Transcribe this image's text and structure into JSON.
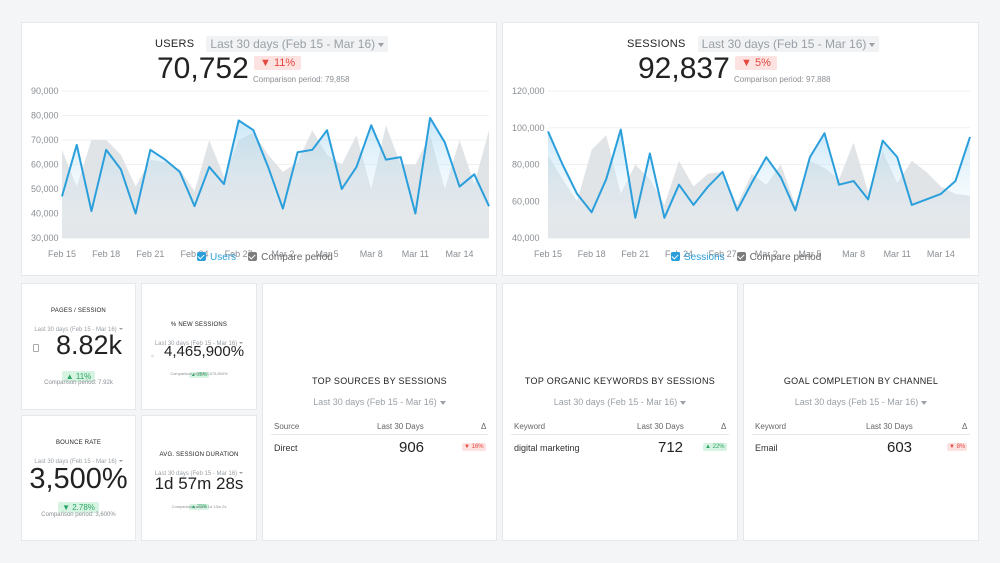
{
  "users": {
    "title": "USERS",
    "date_range": "Last 30 days (Feb 15 - Mar 16)",
    "value": "70,752",
    "change": "11%",
    "comparison": "Comparison period: 79,858",
    "legend_primary": "Users",
    "legend_compare": "Compare period"
  },
  "sessions": {
    "title": "SESSIONS",
    "date_range": "Last 30 days (Feb 15 - Mar 16)",
    "value": "92,837",
    "change": "5%",
    "comparison": "Comparison period: 97,888",
    "legend_primary": "Sessions",
    "legend_compare": "Compare period"
  },
  "pages_session": {
    "title": "PAGES / SESSION",
    "date_range": "Last 30 days (Feb 15 - Mar 16)",
    "value": "8.82k",
    "change": "11%",
    "comparison": "Comparison period: 7.92k"
  },
  "new_sessions": {
    "title": "% NEW SESSIONS",
    "date_range": "Last 30 days (Feb 15 - Mar 16)",
    "value": "4,465,900%",
    "change": "25%",
    "comparison": "Comparison period: 3,575,800%"
  },
  "bounce_rate": {
    "title": "BOUNCE RATE",
    "date_range": "Last 30 days (Feb 15 - Mar 16)",
    "value": "3,500%",
    "change": "2.78%",
    "comparison": "Comparison period: 3,600%"
  },
  "avg_duration": {
    "title": "AVG. SESSION DURATION",
    "date_range": "Last 30 days (Feb 15 - Mar 16)",
    "value": "1d 57m 28s",
    "change": "23%",
    "comparison": "Comparison period: 1d 13m 2s"
  },
  "top_sources": {
    "title": "TOP SOURCES BY SESSIONS",
    "date_range": "Last 30 days (Feb 15 - Mar 16)",
    "col1": "Source",
    "col2": "Last 30 Days",
    "col3": "Δ",
    "row_label": "Direct",
    "row_value": "906",
    "row_change": "16%"
  },
  "top_keywords": {
    "title": "TOP ORGANIC KEYWORDS BY SESSIONS",
    "date_range": "Last 30 days (Feb 15 - Mar 16)",
    "col1": "Keyword",
    "col2": "Last 30 Days",
    "col3": "Δ",
    "row_label": "digital marketing",
    "row_value": "712",
    "row_change": "22%"
  },
  "goal_completion": {
    "title": "GOAL COMPLETION BY CHANNEL",
    "date_range": "Last 30 days (Feb 15 - Mar 16)",
    "col1": "Keyword",
    "col2": "Last 30 Days",
    "col3": "Δ",
    "row_label": "Email",
    "row_value": "603",
    "row_change": "8%"
  },
  "chart_data": [
    {
      "type": "area",
      "ylim": [
        30000,
        90000
      ],
      "yticks": [
        "30,000",
        "40,000",
        "50,000",
        "60,000",
        "70,000",
        "80,000",
        "90,000"
      ],
      "ytick_values": [
        30000,
        40000,
        50000,
        60000,
        70000,
        80000,
        90000
      ],
      "xticks": [
        "Feb 15",
        "Feb 18",
        "Feb 21",
        "Feb 24",
        "Feb 27",
        "Mar 2",
        "Mar 5",
        "Mar 8",
        "Mar 11",
        "Mar 14"
      ],
      "series": [
        {
          "name": "Users",
          "values": [
            47000,
            68000,
            41000,
            66000,
            58000,
            40000,
            66000,
            62000,
            57000,
            43000,
            59000,
            52000,
            78000,
            74000,
            59000,
            42000,
            65000,
            66000,
            74000,
            50000,
            59000,
            76000,
            62000,
            63000,
            40000,
            79000,
            69000,
            51000,
            56000,
            43000
          ]
        },
        {
          "name": "Compare period",
          "values": [
            66000,
            51000,
            70000,
            70000,
            64000,
            51000,
            62000,
            61000,
            58000,
            49000,
            70000,
            55000,
            70000,
            73000,
            64000,
            57000,
            61000,
            74000,
            64000,
            60000,
            72000,
            50000,
            76000,
            60000,
            60000,
            72000,
            50000,
            70000,
            52000,
            74000
          ]
        }
      ]
    },
    {
      "type": "area",
      "ylim": [
        40000,
        120000
      ],
      "yticks": [
        "40,000",
        "60,000",
        "80,000",
        "100,000",
        "120,000"
      ],
      "ytick_values": [
        40000,
        60000,
        80000,
        100000,
        120000
      ],
      "xticks": [
        "Feb 15",
        "Feb 18",
        "Feb 21",
        "Feb 24",
        "Feb 27",
        "Mar 2",
        "Mar 5",
        "Mar 8",
        "Mar 11",
        "Mar 14"
      ],
      "series": [
        {
          "name": "Sessions",
          "values": [
            98000,
            80000,
            64000,
            54000,
            72000,
            99000,
            51000,
            86000,
            51000,
            69000,
            58000,
            68000,
            76000,
            55000,
            70000,
            84000,
            73000,
            55000,
            84000,
            97000,
            69000,
            71000,
            61000,
            93000,
            84000,
            58000,
            61000,
            64000,
            71000,
            95000
          ]
        },
        {
          "name": "Compare period",
          "values": [
            85000,
            72000,
            60000,
            88000,
            96000,
            64000,
            80000,
            72000,
            58000,
            82000,
            68000,
            75000,
            76000,
            58000,
            75000,
            69000,
            80000,
            58000,
            82000,
            78000,
            72000,
            92000,
            65000,
            87000,
            70000,
            82000,
            76000,
            68000,
            64000,
            63000
          ]
        }
      ]
    }
  ]
}
